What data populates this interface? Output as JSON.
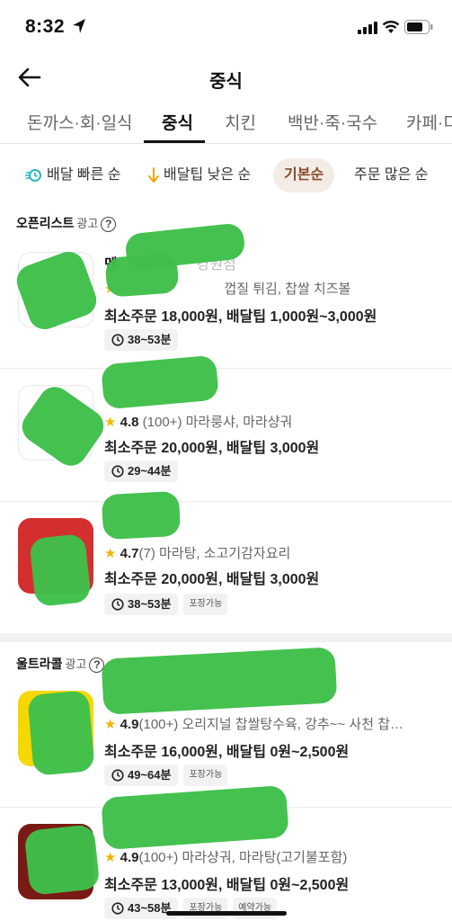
{
  "status_bar": {
    "time": "8:32"
  },
  "header": {
    "title": "중식"
  },
  "tabs": [
    {
      "label": "돈까스·회·일식",
      "active": false
    },
    {
      "label": "중식",
      "active": true
    },
    {
      "label": "치킨",
      "active": false
    },
    {
      "label": "백반·죽·국수",
      "active": false
    },
    {
      "label": "카페·디",
      "active": false
    }
  ],
  "sort_options": [
    {
      "label": "배달 빠른 순",
      "icon": "fast-delivery-icon",
      "active": false
    },
    {
      "label": "배달팁 낮은 순",
      "icon": "arrow-down-icon",
      "active": false
    },
    {
      "label": "기본순",
      "icon": "",
      "active": true
    },
    {
      "label": "주문 많은 순",
      "icon": "",
      "active": false
    }
  ],
  "colors": {
    "accent_active_chip_bg": "#f3ece6",
    "accent_active_chip_text": "#8a4a2c",
    "star": "#f5b400",
    "redaction": "#3fbf4a"
  },
  "sections": [
    {
      "label": "오픈리스트",
      "ad_label": "광고",
      "stores": [
        {
          "name": "멘",
          "rating": "",
          "reviews": "",
          "menu": "껍질 튀김, 찹쌀 치즈볼",
          "name_suffix": "강원점",
          "min_order": "최소주문 18,000원, 배달팁 1,000원~3,000원",
          "time": "38~53분",
          "badges": []
        },
        {
          "name": "",
          "rating": "4.8",
          "reviews": "(100+)",
          "menu": "마라룽샤, 마라샹궈",
          "min_order": "최소주문 20,000원, 배달팁 3,000원",
          "time": "29~44분",
          "badges": []
        },
        {
          "name": "",
          "rating": "4.7",
          "reviews": "(7)",
          "menu": "마라탕, 소고기감자요리",
          "min_order": "최소주문 20,000원, 배달팁 3,000원",
          "time": "38~53분",
          "badges": [
            "포장가능"
          ]
        }
      ]
    },
    {
      "label": "울트라콜",
      "ad_label": "광고",
      "stores": [
        {
          "name": "",
          "rating": "4.9",
          "reviews": "(100+)",
          "menu": "오리지널 찹쌀탕수육, 강추~~ 사천 찹…",
          "min_order": "최소주문 16,000원, 배달팁 0원~2,500원",
          "time": "49~64분",
          "badges": [
            "포장가능"
          ]
        },
        {
          "name": "",
          "rating": "4.9",
          "reviews": "(100+)",
          "menu": "마라샹궈, 마라탕(고기불포함)",
          "min_order": "최소주문 13,000원, 배달팁 0원~2,500원",
          "time": "43~58분",
          "badges": [
            "포장가능",
            "예약가능"
          ]
        }
      ]
    }
  ]
}
